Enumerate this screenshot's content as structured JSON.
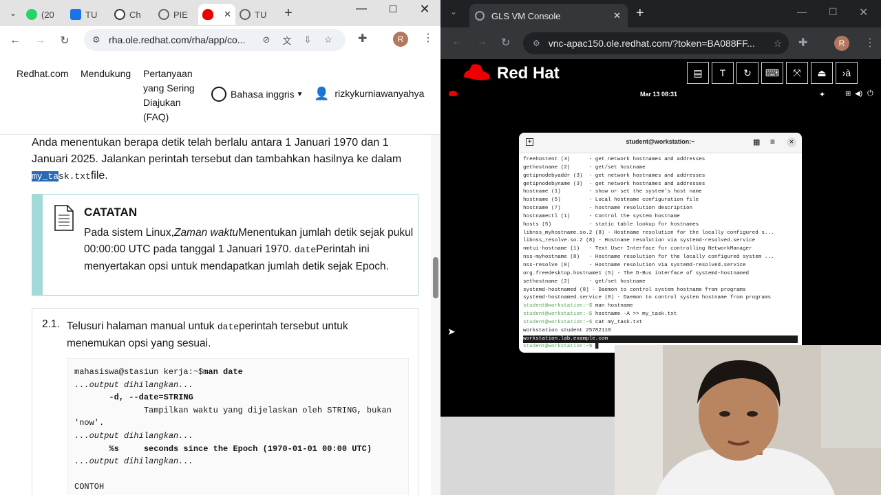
{
  "left_browser": {
    "tabs": [
      {
        "label": "(20",
        "icon": "whatsapp-icon",
        "color": "#25d366"
      },
      {
        "label": "TU",
        "icon": "classroom-icon",
        "color": "#1a73e8"
      },
      {
        "label": "Ch",
        "icon": "chatgpt-icon",
        "color": "#333333"
      },
      {
        "label": "PIE",
        "icon": "globe-icon",
        "color": "#5f6368"
      },
      {
        "label": "",
        "icon": "redhat-icon",
        "color": "#ee0000"
      },
      {
        "label": "TU",
        "icon": "globe-icon",
        "color": "#5f6368"
      }
    ],
    "url": "rha.ole.redhat.com/rha/app/co...",
    "profile_initial": "R"
  },
  "site_nav": {
    "links": [
      "Redhat.com",
      "Mendukung"
    ],
    "faq_lines": [
      "Pertanyaan",
      "yang Sering",
      "Diajukan",
      "(FAQ)"
    ],
    "language": "Bahasa inggris",
    "user": "rizkykurniawanyahya"
  },
  "content": {
    "intro_line1": "Anda menentukan berapa detik telah berlalu antara 1 Januari 1970 dan 1",
    "intro_line2": "Januari 2025. Jalankan perintah tersebut dan tambahkan hasilnya ke dalam",
    "file_sel_a": "my_ta",
    "file_sel_b": "sk.txt",
    "file_suffix": "file.",
    "note_title": "CATATAN",
    "note_p1": "Pada sistem Linux,",
    "note_italic": "Zaman waktu",
    "note_p2": "Menentukan jumlah detik sejak pukul 00:00:00 UTC pada tanggal 1 Januari 1970. ",
    "note_code": "date",
    "note_p3": "Perintah ini menyertakan opsi untuk mendapatkan jumlah detik sejak Epoch.",
    "step_number": "2.1.",
    "step_t1": "Telusuri halaman manual untuk ",
    "step_code": "date",
    "step_t2": "perintah tersebut untuk menemukan opsi yang sesuai.",
    "code_lines": {
      "l1a": "mahasiswa@stasiun kerja:~$",
      "l1b": "man date",
      "l2": "...output dihilangkan...",
      "l3": "       -d, --date=STRING",
      "l4": "              Tampilkan waktu yang dijelaskan oleh STRING, bukan",
      "l5": "'now'.",
      "l6": "...output dihilangkan...",
      "l7": "       %s     seconds since the Epoch (1970-01-01 00:00 UTC)",
      "l8": "...output dihilangkan...",
      "l9": "CONTOH"
    }
  },
  "right_browser": {
    "tab_title": "GLS VM Console",
    "url": "vnc-apac150.ole.redhat.com/?token=BA088FF...",
    "profile_initial": "R"
  },
  "vnc": {
    "brand": "Red Hat",
    "clock": "Mar 13  08:31",
    "terminal_title": "student@workstation:~",
    "terminal_lines": [
      "freehostent (3)      - get network hostnames and addresses",
      "gethostname (2)      - get/set hostname",
      "getipnodebyaddr (3)  - get network hostnames and addresses",
      "getipnodebyname (3)  - get network hostnames and addresses",
      "hostname (1)         - show or set the system's host name",
      "hostname (5)         - Local hostname configuration file",
      "hostname (7)         - hostname resolution description",
      "hostnamectl (1)      - Control the system hostname",
      "hosts (5)            - static table lookup for hostnames",
      "libnss_myhostname.so.2 (8) - Hostname resolution for the locally configured s...",
      "libnss_resolve.so.2 (8) - Hostname resolution via systemd-resolved.service",
      "nmtui-hostname (1)   - Text User Interface for controlling NetworkManager",
      "nss-myhostname (8)   - Hostname resolution for the locally configured system ...",
      "nss-resolve (8)      - Hostname resolution via systemd-resolved.service",
      "org.freedesktop.hostname1 (5) - The D-Bus interface of systemd-hostnamed",
      "sethostname (2)      - get/set hostname",
      "systemd-hostnamed (8) - Daemon to control system hostname from programs",
      "systemd-hostnamed.service (8) - Daemon to control system hostname from programs"
    ],
    "prompt": "student@workstation:~$",
    "cmd1": " man hostname",
    "cmd2": " hostname -A >> my_task.txt",
    "cmd3": " cat my_task.txt",
    "out1": "workstation student 25782110",
    "out2": "workstation.lab.example.com"
  }
}
